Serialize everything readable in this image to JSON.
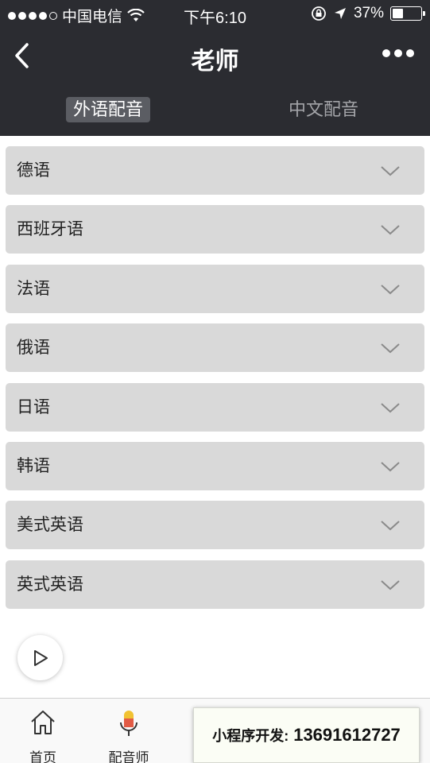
{
  "status_bar": {
    "carrier": "中国电信",
    "time": "下午6:10",
    "battery_text": "37%",
    "battery_level": 0.37
  },
  "nav": {
    "title": "老师"
  },
  "tabs": [
    {
      "label": "外语配音",
      "active": true
    },
    {
      "label": "中文配音",
      "active": false
    }
  ],
  "languages": [
    {
      "label": "德语"
    },
    {
      "label": "西班牙语"
    },
    {
      "label": "法语"
    },
    {
      "label": "俄语"
    },
    {
      "label": "日语"
    },
    {
      "label": "韩语"
    },
    {
      "label": "美式英语"
    },
    {
      "label": "英式英语"
    }
  ],
  "bottom_tabs": [
    {
      "label": "首页",
      "icon": "home-icon"
    },
    {
      "label": "配音师",
      "icon": "microphone-icon"
    }
  ],
  "promo": {
    "label": "小程序开发:",
    "phone": "13691612727"
  },
  "colors": {
    "header_bg": "#2b2c31",
    "item_bg": "#d9d9d9",
    "active_tab_bg": "#5b5d63"
  }
}
